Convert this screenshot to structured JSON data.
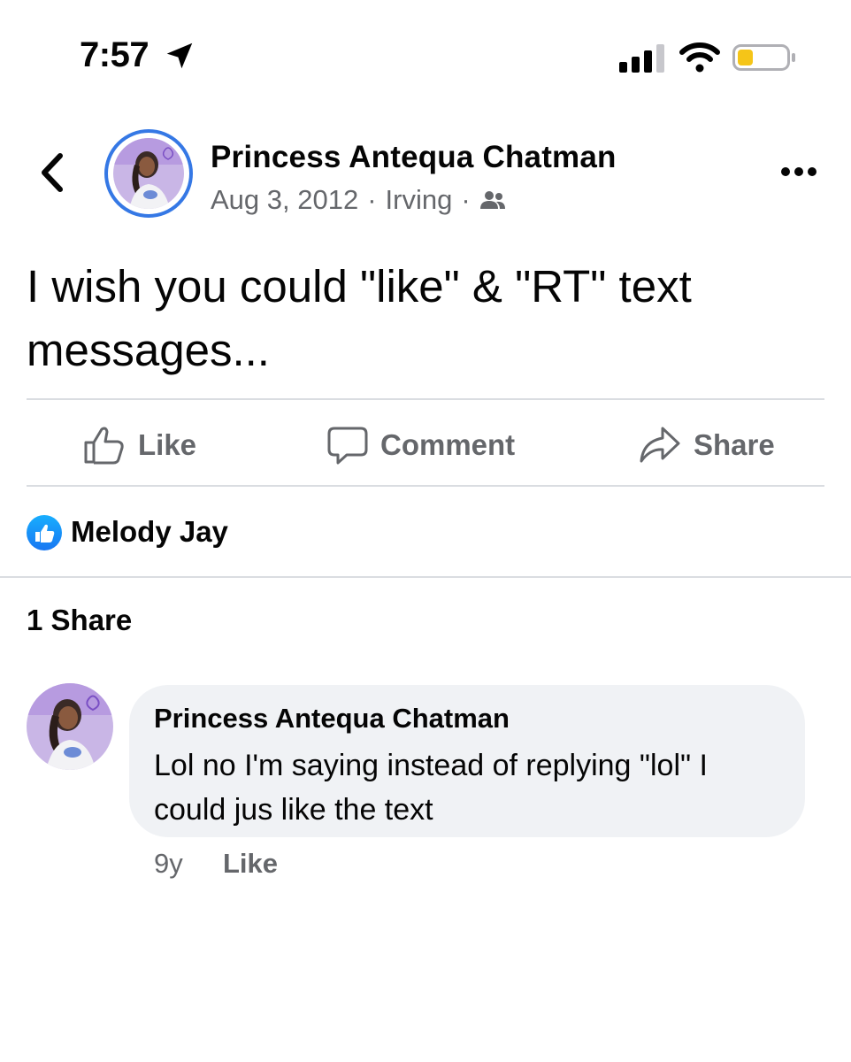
{
  "status_bar": {
    "time": "7:57"
  },
  "post": {
    "author": "Princess Antequa Chatman",
    "date": "Aug 3, 2012",
    "location": "Irving",
    "separator": "·",
    "audience_icon": "friends-icon",
    "text": "I wish you could \"like\" & \"RT\" text messages..."
  },
  "actions": {
    "like_label": "Like",
    "comment_label": "Comment",
    "share_label": "Share"
  },
  "reactions": {
    "icon": "like-reaction-icon",
    "names": "Melody Jay"
  },
  "shares": {
    "label": "1 Share"
  },
  "comments": [
    {
      "author": "Princess Antequa Chatman",
      "text": "Lol no I'm saying instead of replying \"lol\" I could jus like the text",
      "time": "9y",
      "like_label": "Like"
    }
  ],
  "colors": {
    "accent": "#1877f2",
    "ring": "#3578e5",
    "secondary_text": "#65676b",
    "bubble": "#f0f2f5",
    "battery_fill": "#f5c518"
  }
}
